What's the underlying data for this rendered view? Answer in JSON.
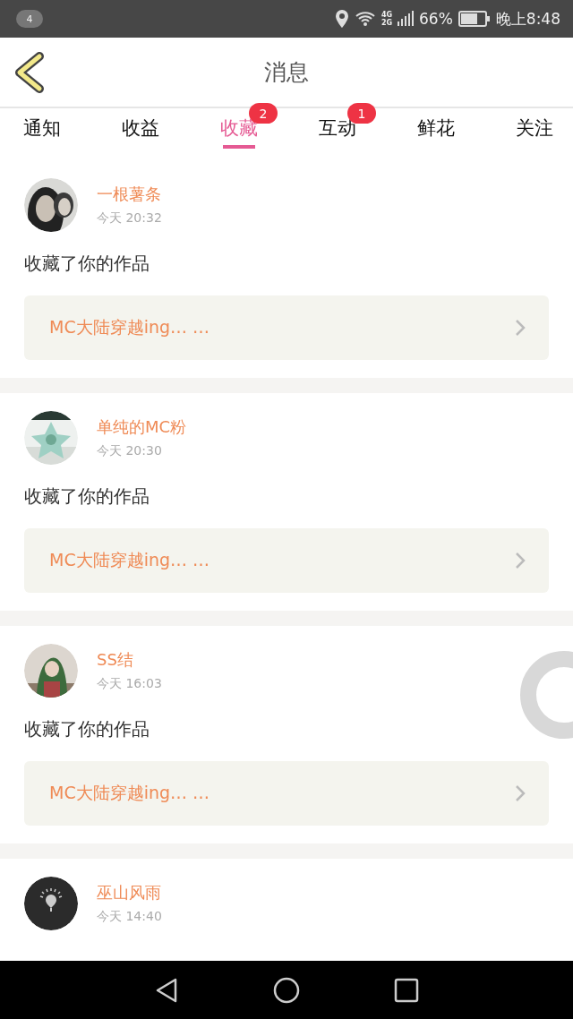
{
  "status_bar": {
    "notification_count": "4",
    "network_top": "4G",
    "network_bottom": "2G",
    "battery": "66%",
    "time": "晚上8:48"
  },
  "header": {
    "title": "消息"
  },
  "tabs": [
    {
      "label": "通知",
      "selected": false
    },
    {
      "label": "收益",
      "selected": false
    },
    {
      "label": "收藏",
      "selected": true,
      "badge": "2"
    },
    {
      "label": "互动",
      "selected": false,
      "badge": "1"
    },
    {
      "label": "鲜花",
      "selected": false
    },
    {
      "label": "关注",
      "selected": false
    }
  ],
  "posts": [
    {
      "user": "一根薯条",
      "time": "今天 20:32",
      "message": "收藏了你的作品",
      "work": "MC大陆穿越ing… …"
    },
    {
      "user": "单纯的MC粉",
      "time": "今天 20:30",
      "message": "收藏了你的作品",
      "work": "MC大陆穿越ing… …"
    },
    {
      "user": "SS结",
      "time": "今天 16:03",
      "message": "收藏了你的作品",
      "work": "MC大陆穿越ing… …"
    },
    {
      "user": "巫山风雨",
      "time": "今天 14:40"
    }
  ]
}
